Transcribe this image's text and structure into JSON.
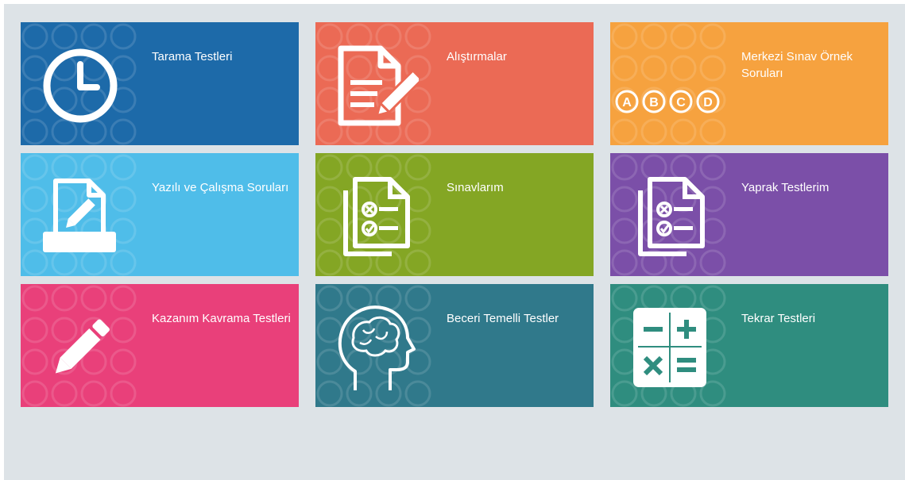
{
  "tiles": [
    {
      "label": "Tarama Testleri",
      "color": "#1d6aa9",
      "icon": "clock-icon"
    },
    {
      "label": "Alıştırmalar",
      "color": "#eb6a55",
      "icon": "document-pencil-icon"
    },
    {
      "label": "Merkezi Sınav Örnek Soruları",
      "color": "#f6a23f",
      "icon": "abcd-options-icon",
      "icon_letters": [
        "A",
        "B",
        "C",
        "D"
      ]
    },
    {
      "label": "Yazılı ve Çalışma Soruları",
      "color": "#4fbde9",
      "icon": "printer-document-icon"
    },
    {
      "label": "Sınavlarım",
      "color": "#84a624",
      "icon": "checklist-documents-icon"
    },
    {
      "label": "Yaprak Testlerim",
      "color": "#7b4fa8",
      "icon": "checklist-documents-icon"
    },
    {
      "label": "Kazanım Kavrama Testleri",
      "color": "#e9407a",
      "icon": "pencil-icon"
    },
    {
      "label": "Beceri Temelli Testler",
      "color": "#30798b",
      "icon": "brain-head-icon"
    },
    {
      "label": "Tekrar Testleri",
      "color": "#2f8d7f",
      "icon": "calculator-icon"
    }
  ]
}
